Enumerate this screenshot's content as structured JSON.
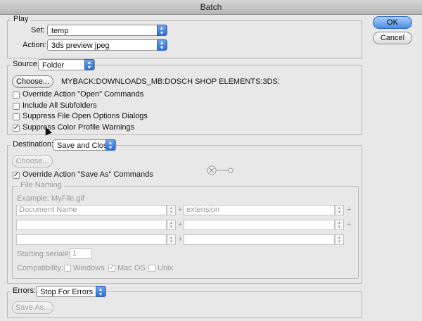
{
  "window": {
    "title": "Batch"
  },
  "buttons": {
    "ok": "OK",
    "cancel": "Cancel"
  },
  "play": {
    "group_label": "Play",
    "set_label": "Set:",
    "set_value": "temp",
    "action_label": "Action:",
    "action_value": "3ds preview jpeg"
  },
  "source": {
    "label": "Source:",
    "value": "Folder",
    "choose_label": "Choose...",
    "path": "MYBACK:DOWNLOADS_MB:DOSCH SHOP ELEMENTS:3DS:",
    "options": [
      {
        "label": "Override Action \"Open\" Commands",
        "checked": false
      },
      {
        "label": "Include All Subfolders",
        "checked": false
      },
      {
        "label": "Suppress File Open Options Dialogs",
        "checked": false
      },
      {
        "label": "Suppress Color Profile Warnings",
        "checked": true
      }
    ]
  },
  "destination": {
    "label": "Destination:",
    "value": "Save and Close",
    "choose_label": "Choose...",
    "override_label": "Override Action \"Save As\" Commands",
    "override_checked": true,
    "file_naming": {
      "group_label": "File Naming",
      "example": "Example: MyFile.gif",
      "rows": [
        {
          "left": "Document Name",
          "right": "extension"
        },
        {
          "left": "",
          "right": ""
        },
        {
          "left": "",
          "right": ""
        }
      ],
      "plus": "+",
      "serial_label": "Starting serial#:",
      "serial_value": "1",
      "compat_label": "Compatibility:",
      "compat": [
        {
          "label": "Windows",
          "checked": false
        },
        {
          "label": "Mac OS",
          "checked": true
        },
        {
          "label": "Unix",
          "checked": false
        }
      ]
    }
  },
  "errors": {
    "label": "Errors:",
    "value": "Stop For Errors",
    "save_as_label": "Save As..."
  },
  "icons": {
    "checkmark": "✓",
    "popup_arrows": "▲▼"
  }
}
